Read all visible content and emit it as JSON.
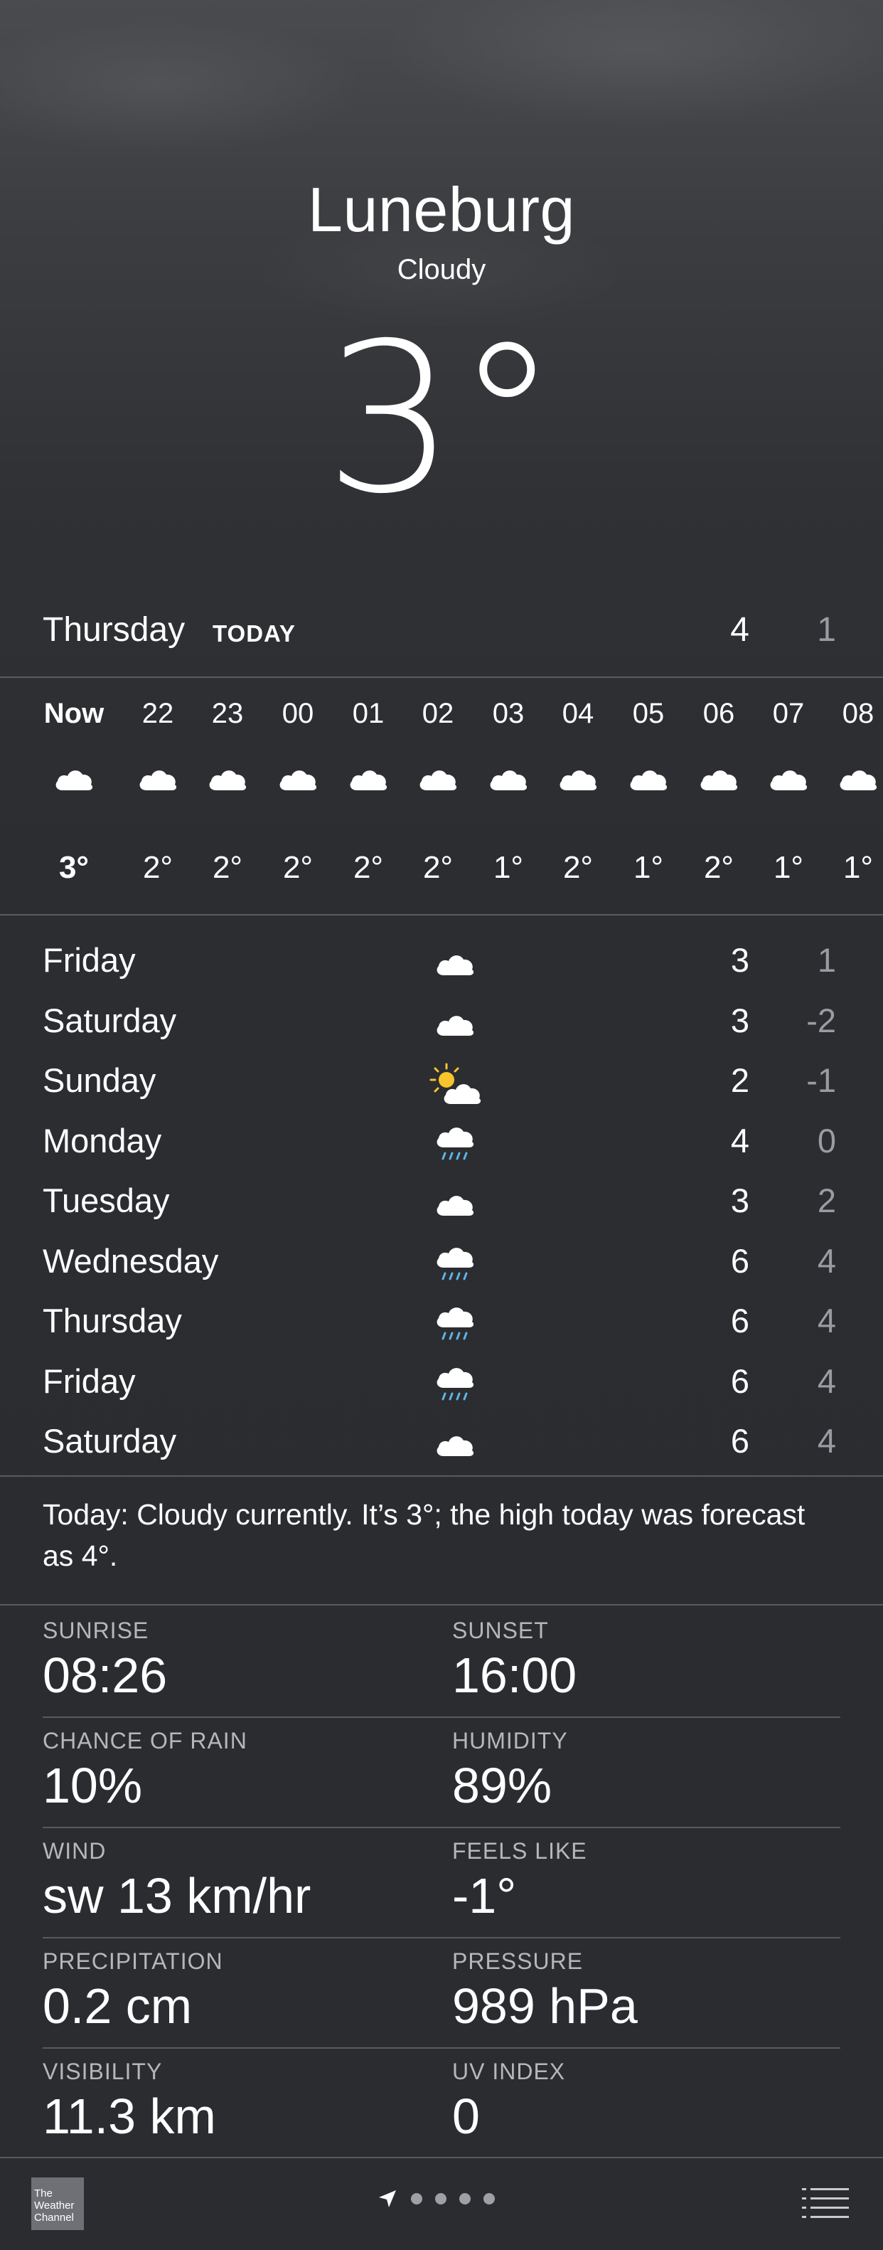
{
  "location": {
    "city": "Luneburg",
    "condition": "Cloudy",
    "temperature": "3°"
  },
  "today": {
    "day": "Thursday",
    "label": "TODAY",
    "high": "4",
    "low": "1"
  },
  "hourly": [
    {
      "time": "Now",
      "icon": "cloud-icon",
      "temp": "3°"
    },
    {
      "time": "22",
      "icon": "cloud-icon",
      "temp": "2°"
    },
    {
      "time": "23",
      "icon": "cloud-icon",
      "temp": "2°"
    },
    {
      "time": "00",
      "icon": "cloud-icon",
      "temp": "2°"
    },
    {
      "time": "01",
      "icon": "cloud-icon",
      "temp": "2°"
    },
    {
      "time": "02",
      "icon": "cloud-icon",
      "temp": "2°"
    },
    {
      "time": "03",
      "icon": "cloud-icon",
      "temp": "1°"
    },
    {
      "time": "04",
      "icon": "cloud-icon",
      "temp": "2°"
    },
    {
      "time": "05",
      "icon": "cloud-icon",
      "temp": "1°"
    },
    {
      "time": "06",
      "icon": "cloud-icon",
      "temp": "2°"
    },
    {
      "time": "07",
      "icon": "cloud-icon",
      "temp": "1°"
    },
    {
      "time": "08",
      "icon": "cloud-icon",
      "temp": "1°"
    }
  ],
  "daily": [
    {
      "day": "Friday",
      "icon": "cloud-icon",
      "high": "3",
      "low": "1"
    },
    {
      "day": "Saturday",
      "icon": "cloud-icon",
      "high": "3",
      "low": "-2"
    },
    {
      "day": "Sunday",
      "icon": "partly-sunny-icon",
      "high": "2",
      "low": "-1"
    },
    {
      "day": "Monday",
      "icon": "rain-icon",
      "high": "4",
      "low": "0"
    },
    {
      "day": "Tuesday",
      "icon": "cloud-icon",
      "high": "3",
      "low": "2"
    },
    {
      "day": "Wednesday",
      "icon": "rain-icon",
      "high": "6",
      "low": "4"
    },
    {
      "day": "Thursday",
      "icon": "rain-icon",
      "high": "6",
      "low": "4"
    },
    {
      "day": "Friday",
      "icon": "rain-icon",
      "high": "6",
      "low": "4"
    },
    {
      "day": "Saturday",
      "icon": "cloud-icon",
      "high": "6",
      "low": "4"
    }
  ],
  "summary": "Today: Cloudy currently. It’s 3°; the high today was forecast as 4°.",
  "details": {
    "sunrise_label": "SUNRISE",
    "sunrise": "08:26",
    "sunset_label": "SUNSET",
    "sunset": "16:00",
    "rain_label": "CHANCE OF RAIN",
    "rain": "10%",
    "humidity_label": "HUMIDITY",
    "humidity": "89%",
    "wind_label": "WIND",
    "wind": "sw 13 km/hr",
    "feels_label": "FEELS LIKE",
    "feels": "-1°",
    "precip_label": "PRECIPITATION",
    "precip": "0.2 cm",
    "pressure_label": "PRESSURE",
    "pressure": "989 hPa",
    "visibility_label": "VISIBILITY",
    "visibility": "11.3 km",
    "uv_label": "UV INDEX",
    "uv": "0"
  },
  "footer": {
    "logo_text": "The Weather Channel",
    "icons": [
      "location-arrow-icon",
      "list-icon"
    ],
    "page_count": 5
  },
  "colors": {
    "text": "#ffffff",
    "secondary_text": "#9a9ca1",
    "sun": "#f7c52b",
    "rain": "#5fb4e6"
  }
}
